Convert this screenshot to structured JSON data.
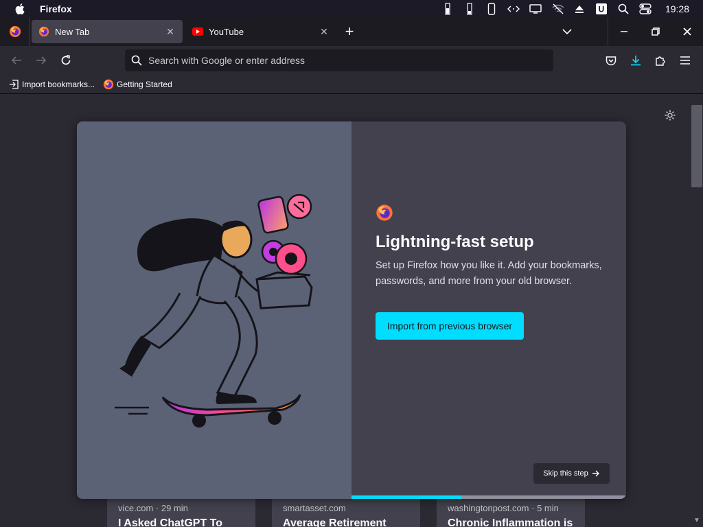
{
  "menubar": {
    "app_name": "Firefox",
    "clock": "19:28"
  },
  "tabs": [
    {
      "label": "New Tab",
      "icon": "firefox-icon",
      "active": true
    },
    {
      "label": "YouTube",
      "icon": "youtube-icon",
      "active": false
    }
  ],
  "urlbar": {
    "placeholder": "Search with Google or enter address",
    "value": ""
  },
  "bookmarks": [
    {
      "label": "Import bookmarks...",
      "icon": "import-icon"
    },
    {
      "label": "Getting Started",
      "icon": "firefox-icon"
    }
  ],
  "onboarding": {
    "title": "Lightning-fast setup",
    "description": "Set up Firefox how you like it. Add your bookmarks, passwords, and more from your old browser.",
    "primary_button": "Import from previous browser",
    "skip_button": "Skip this step",
    "progress": 0.4
  },
  "stories": [
    {
      "source": "vice.com · 29 min",
      "title": "I Asked ChatGPT To"
    },
    {
      "source": "smartasset.com",
      "title": "Average Retirement"
    },
    {
      "source": "washingtonpost.com · 5 min",
      "title": "Chronic Inflammation is"
    }
  ],
  "colors": {
    "accent": "#00ddff",
    "modal_left": "#5b6275",
    "modal_right": "#42414d"
  }
}
